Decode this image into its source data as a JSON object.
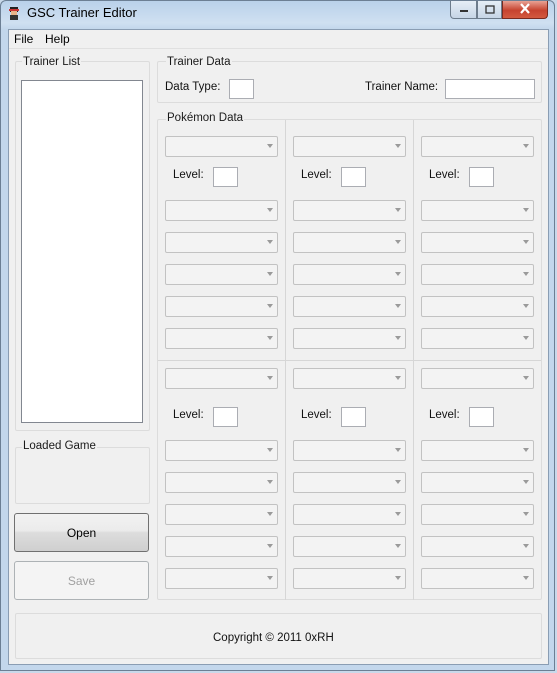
{
  "window": {
    "title": "GSC Trainer Editor"
  },
  "menu": {
    "file": "File",
    "help": "Help"
  },
  "trainer_list": {
    "label": "Trainer List"
  },
  "loaded_game": {
    "label": "Loaded Game"
  },
  "buttons": {
    "open": "Open",
    "save": "Save"
  },
  "trainer_data": {
    "label": "Trainer Data",
    "data_type_label": "Data Type:",
    "trainer_name_label": "Trainer Name:"
  },
  "pokemon_data": {
    "label": "Pokémon Data",
    "level_label": "Level:"
  },
  "footer": {
    "copyright": "Copyright © 2011 0xRH"
  }
}
